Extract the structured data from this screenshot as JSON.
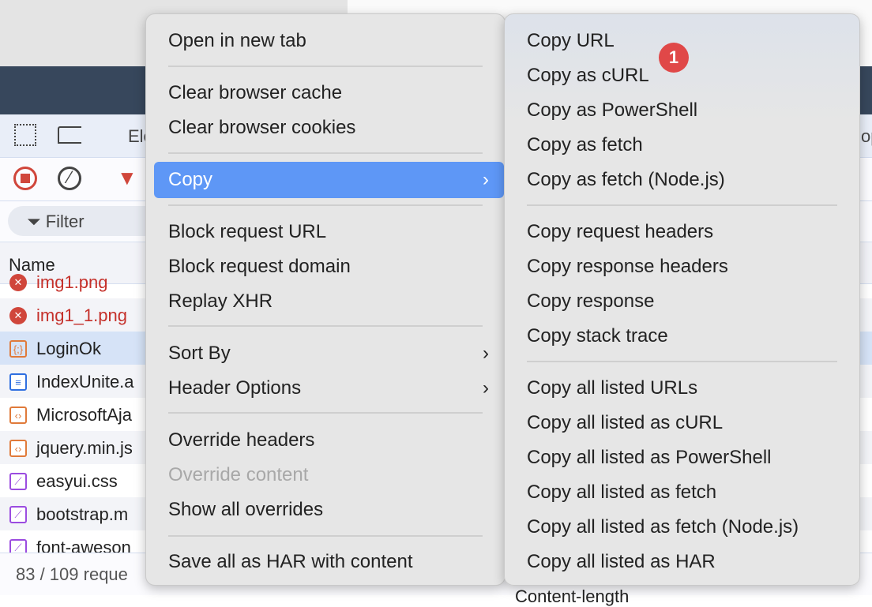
{
  "devtools": {
    "tab_partial": "Ele",
    "right_partial": "op",
    "filter_placeholder": "Filter",
    "name_header": "Name",
    "rows": [
      {
        "name": "img1.png",
        "type": "error"
      },
      {
        "name": "img1_1.png",
        "type": "error"
      },
      {
        "name": "LoginOk",
        "type": "xhr"
      },
      {
        "name": "IndexUnite.a",
        "type": "document"
      },
      {
        "name": "MicrosoftAja",
        "type": "script"
      },
      {
        "name": "jquery.min.js",
        "type": "script"
      },
      {
        "name": "easyui.css",
        "type": "stylesheet"
      },
      {
        "name": "bootstrap.m",
        "type": "stylesheet"
      },
      {
        "name": "font-aweson",
        "type": "stylesheet"
      }
    ],
    "footer": "83 / 109 reque",
    "bottom_partial": "Content-length"
  },
  "context_menu": {
    "items": [
      "Open in new tab",
      "Clear browser cache",
      "Clear browser cookies",
      "Copy",
      "Block request URL",
      "Block request domain",
      "Replay XHR",
      "Sort By",
      "Header Options",
      "Override headers",
      "Override content",
      "Show all overrides",
      "Save all as HAR with content"
    ]
  },
  "copy_submenu": {
    "items": [
      "Copy URL",
      "Copy as cURL",
      "Copy as PowerShell",
      "Copy as fetch",
      "Copy as fetch (Node.js)",
      "Copy request headers",
      "Copy response headers",
      "Copy response",
      "Copy stack trace",
      "Copy all listed URLs",
      "Copy all listed as cURL",
      "Copy all listed as PowerShell",
      "Copy all listed as fetch",
      "Copy all listed as fetch (Node.js)",
      "Copy all listed as HAR"
    ]
  },
  "badge": "1",
  "colors": {
    "highlight": "#5e97f6",
    "badge": "#e04848",
    "navy": "#37475c",
    "error": "#c5302a"
  }
}
